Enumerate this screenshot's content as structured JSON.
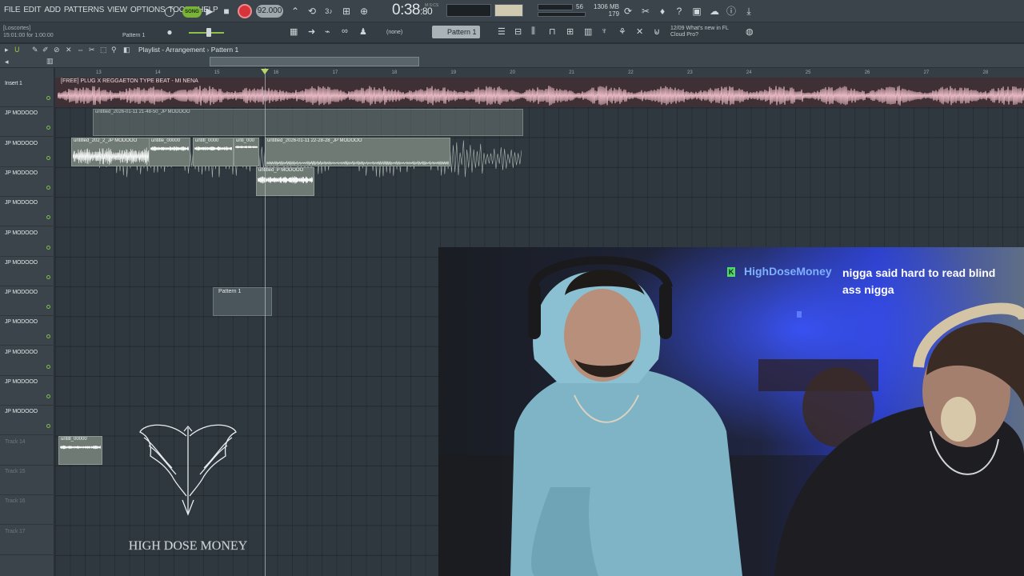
{
  "menu": {
    "items": [
      "FILE",
      "EDIT",
      "ADD",
      "PATTERNS",
      "VIEW",
      "OPTIONS",
      "TOOLS",
      "HELP"
    ]
  },
  "transport": {
    "song_mode": "SONG",
    "tempo": "92.000",
    "time_main": "0:38",
    "time_sub": ":80",
    "time_unit": "M:S:CS",
    "cpu_value": "56",
    "ram_value": "1306 MB",
    "polyphony": "179"
  },
  "toolbar2": {
    "hint_line1": "[Loscortes]",
    "hint_line2": "15:01:00 for 1:00:00",
    "pattern_left": "Pattern 1",
    "mixer_select": "(none)",
    "pattern_select": "Pattern 1",
    "news_date": "12/09",
    "news_line1": "What's new in FL",
    "news_line2": "Cloud Pro?"
  },
  "playlist": {
    "title": "Playlist - Arrangement",
    "breadcrumb_sep": "›",
    "pattern": "Pattern 1",
    "ruler_ticks": [
      "13",
      "14",
      "15",
      "16",
      "17",
      "18",
      "19",
      "20",
      "21",
      "22",
      "23",
      "24",
      "25",
      "26",
      "27",
      "28"
    ]
  },
  "tracks": [
    {
      "name": "Insert 1",
      "dim": false
    },
    {
      "name": "JP MODOOO",
      "dim": false
    },
    {
      "name": "JP MODOOO",
      "dim": false
    },
    {
      "name": "JP MODOOO",
      "dim": false
    },
    {
      "name": "JP MODOOO",
      "dim": false
    },
    {
      "name": "JP MODOOO",
      "dim": false
    },
    {
      "name": "JP MODOOO",
      "dim": false
    },
    {
      "name": "JP MODOOO",
      "dim": false
    },
    {
      "name": "JP MODOOO",
      "dim": false
    },
    {
      "name": "JP MODOOO",
      "dim": false
    },
    {
      "name": "JP MODOOO",
      "dim": false
    },
    {
      "name": "JP MODOOO",
      "dim": false
    },
    {
      "name": "Track 14",
      "dim": true
    },
    {
      "name": "Track 15",
      "dim": true
    },
    {
      "name": "Track 16",
      "dim": true
    },
    {
      "name": "Track 17",
      "dim": true
    }
  ],
  "clips": {
    "beat": "[FREE] PLUG X REGGAETON TYPE BEAT - MI NENA",
    "ghost": "untitled_2026-01-11 21-48-50_JP MODOOO",
    "c1": "untitled_202_2_JP MODOOO",
    "c2": "untitle_00000",
    "c3": "untitl_0000",
    "c4": "unti_000",
    "c5": "untitled_2026-01-11 22-28-28_JP MODOOO",
    "c6": "untitled_P MODOOO",
    "c7": "untitl_00000",
    "pattern_clip": "Pattern 1"
  },
  "chat": {
    "username": "HighDoseMoney",
    "message": "nigga said hard to read blind ass nigga",
    "badge": "K"
  },
  "logo_text": "HIGH DOSE MONEY",
  "colors": {
    "beat_clip": "#3e3034",
    "audio_clip": "#6f7a75",
    "accent_green": "#7ab33a",
    "record": "#d6333a",
    "chat_user": "#7fb0ff"
  }
}
